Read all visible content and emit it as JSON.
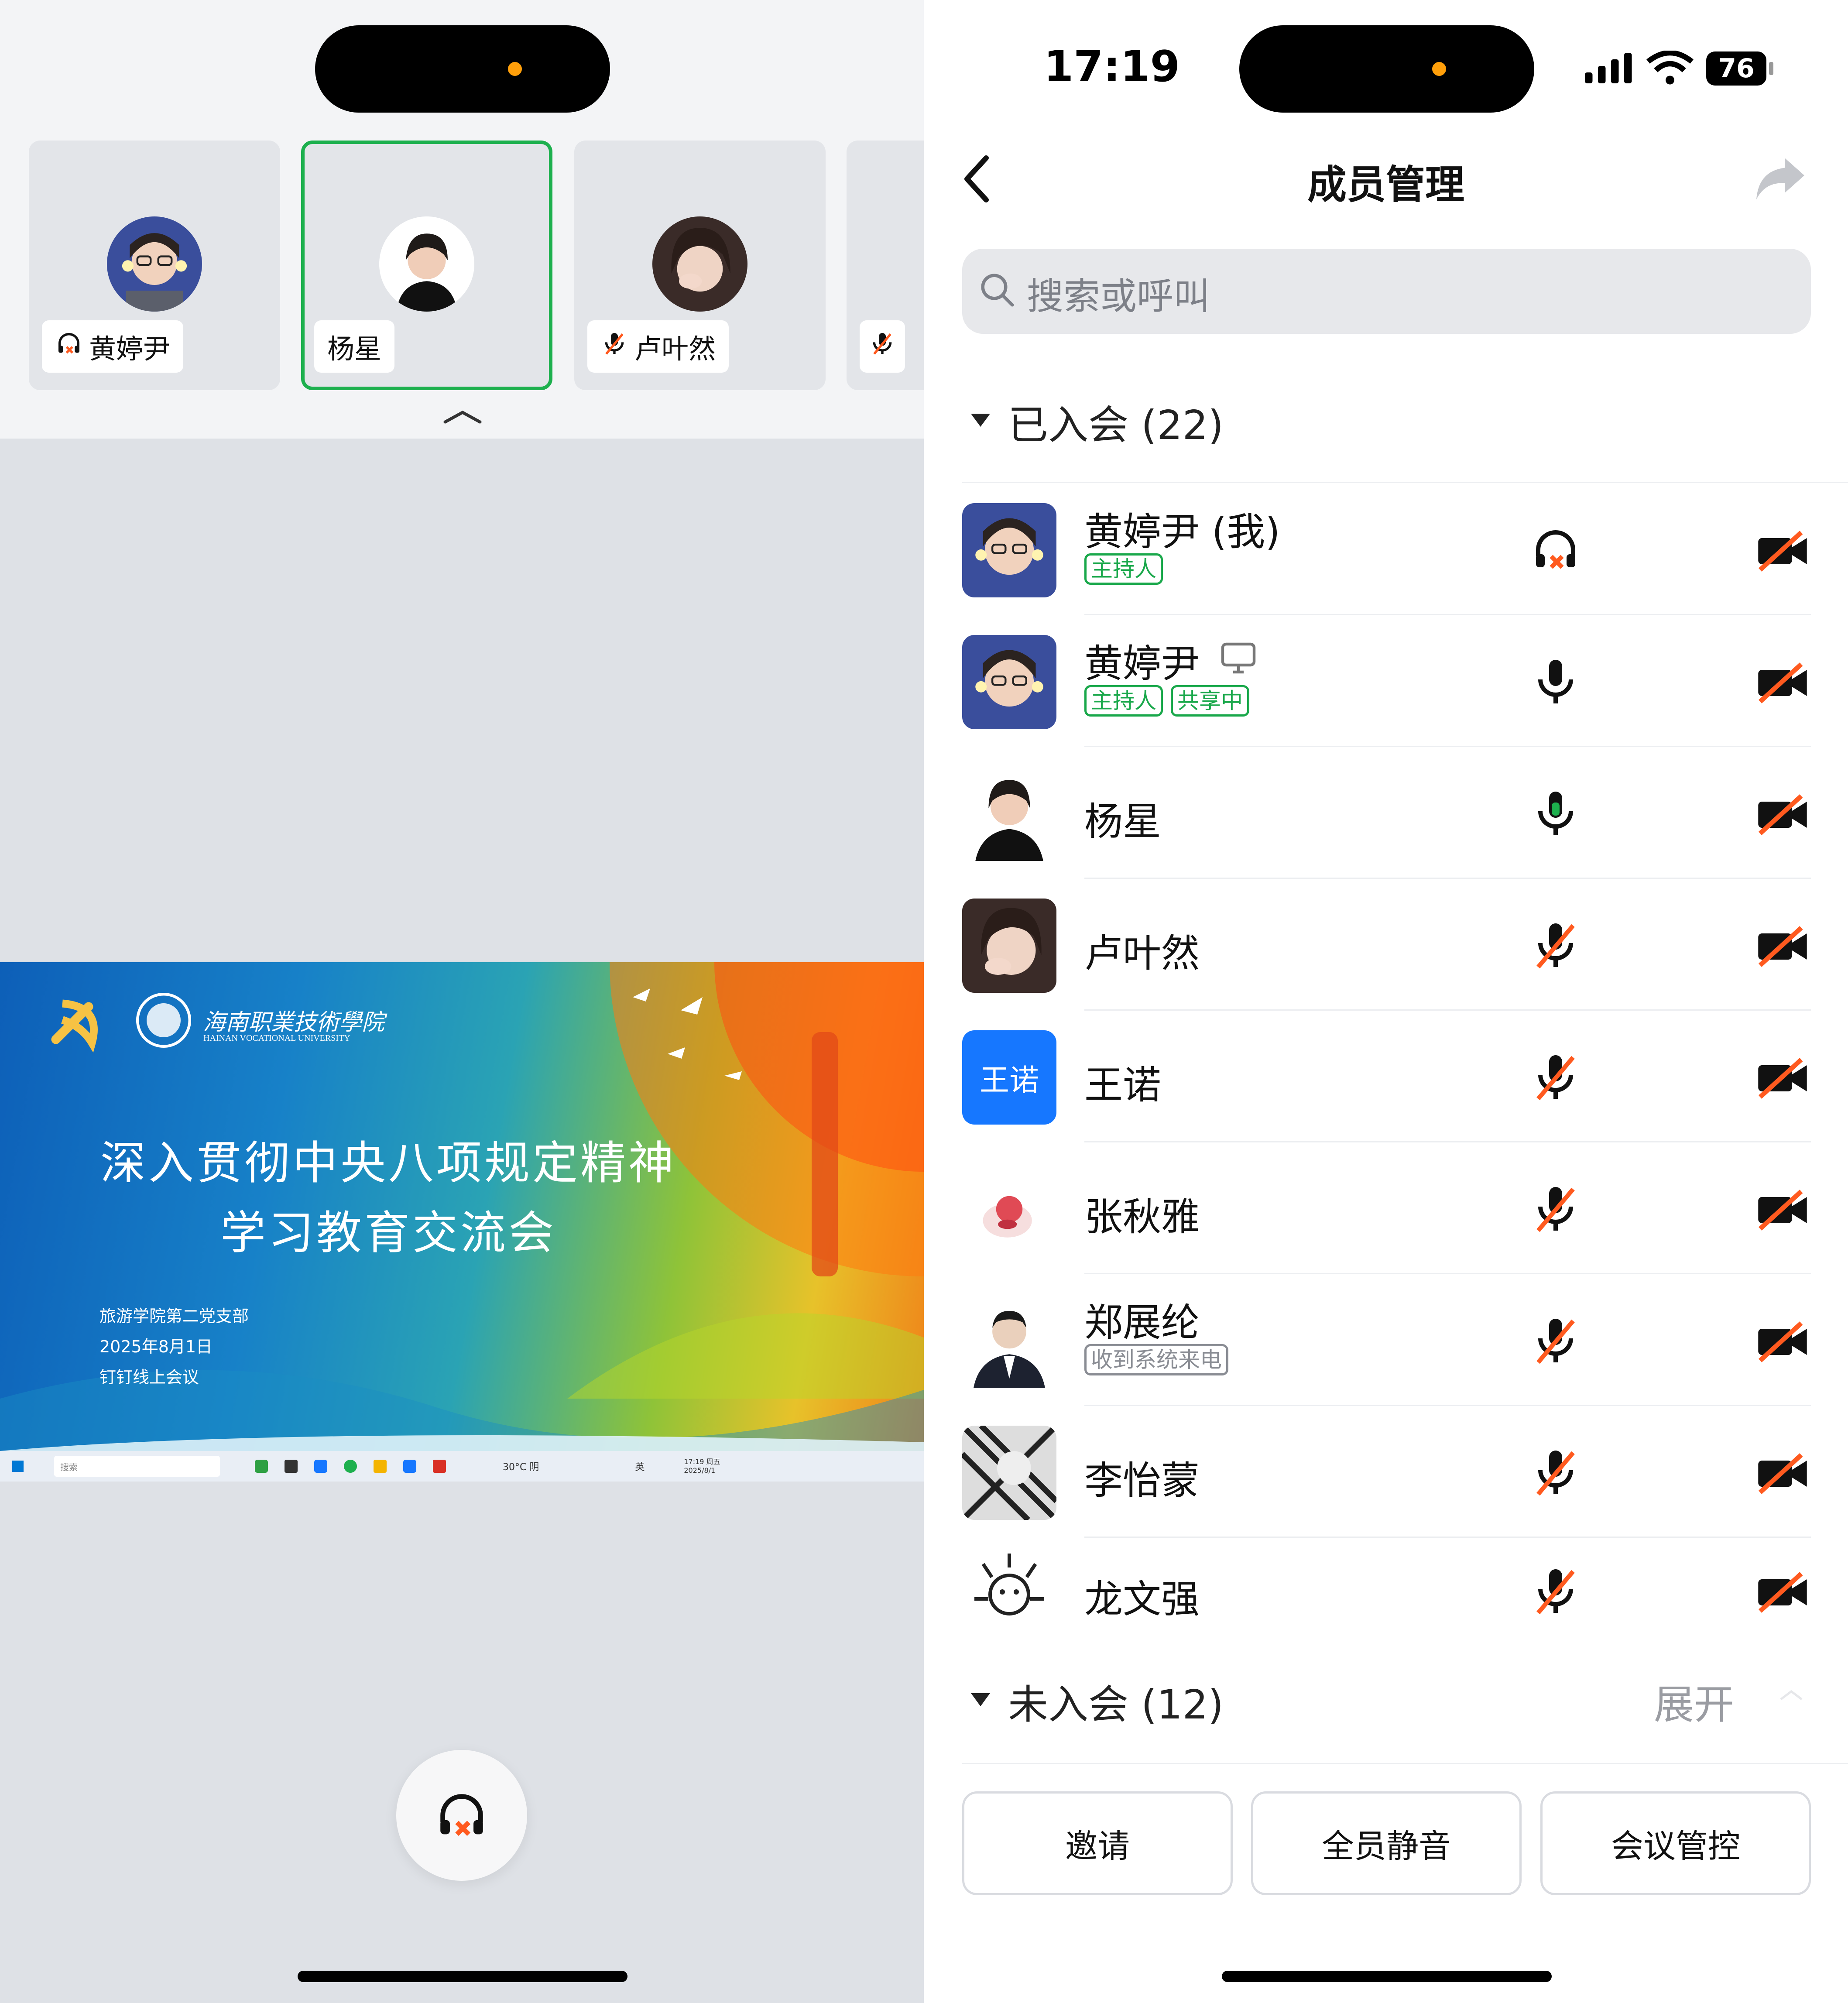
{
  "left_panel": {
    "participants": [
      {
        "name": "黄婷尹",
        "status_icon": "headset-muted-icon",
        "active": false
      },
      {
        "name": "杨星",
        "status_icon": "",
        "active": true
      },
      {
        "name": "卢叶然",
        "status_icon": "mic-muted-icon",
        "active": false
      },
      {
        "name": "",
        "status_icon": "mic-muted-icon",
        "active": false
      }
    ],
    "shared_slide": {
      "school_name": "海南职業技術學院",
      "school_name_en": "HAINAN VOCATIONAL UNIVERSITY",
      "title_line1": "深入贯彻中央八项规定精神",
      "title_line2": "学习教育交流会",
      "info": [
        "旅游学院第二党支部",
        "2025年8月1日",
        "钉钉线上会议"
      ],
      "taskbar": {
        "search_placeholder": "搜索",
        "weather": "30°C 阴",
        "lang": "英",
        "clock_time": "17:19 周五",
        "clock_date": "2025/8/1"
      }
    },
    "bottom_button_icon": "headset-muted-icon"
  },
  "status_bar": {
    "time": "17:19",
    "battery": "76"
  },
  "nav": {
    "title": "成员管理",
    "back_icon": "chevron-left-icon",
    "share_icon": "share-arrow-icon"
  },
  "search": {
    "placeholder": "搜索或呼叫"
  },
  "joined_section": {
    "label": "已入会 (22)"
  },
  "members": [
    {
      "name": "黄婷尹 (我)",
      "tags": [
        "主持人"
      ],
      "mic": "headset-muted",
      "camera": "off",
      "avatar_kind": "photo-woman-glasses"
    },
    {
      "name": "黄婷尹",
      "tags": [
        "主持人",
        "共享中"
      ],
      "mic": "on",
      "camera": "off",
      "avatar_kind": "photo-woman-glasses",
      "screen_icon": true
    },
    {
      "name": "杨星",
      "tags": [],
      "mic": "speaking",
      "camera": "off",
      "avatar_kind": "photo-woman"
    },
    {
      "name": "卢叶然",
      "tags": [],
      "mic": "muted",
      "camera": "off",
      "avatar_kind": "photo-girl"
    },
    {
      "name": "王诺",
      "tags": [],
      "mic": "muted",
      "camera": "off",
      "avatar_kind": "text",
      "avatar_text": "王诺"
    },
    {
      "name": "张秋雅",
      "tags": [],
      "mic": "muted",
      "camera": "off",
      "avatar_kind": "cake"
    },
    {
      "name": "郑展纶",
      "tags": [
        "收到系统来电"
      ],
      "mic": "muted",
      "camera": "off",
      "avatar_kind": "photo-man"
    },
    {
      "name": "李怡蒙",
      "tags": [],
      "mic": "muted",
      "camera": "off",
      "avatar_kind": "sketch"
    },
    {
      "name": "龙文强",
      "tags": [],
      "mic": "muted",
      "camera": "off",
      "avatar_kind": "cartoon"
    }
  ],
  "not_joined_section": {
    "label": "未入会 (12)",
    "expand_label": "展开"
  },
  "footer_buttons": {
    "invite": "邀请",
    "mute_all": "全员静音",
    "meeting_control": "会议管控"
  },
  "colors": {
    "accent_green": "#1db04e",
    "muted_red": "#ff5a1f",
    "avatar_blue": "#1677ff"
  }
}
